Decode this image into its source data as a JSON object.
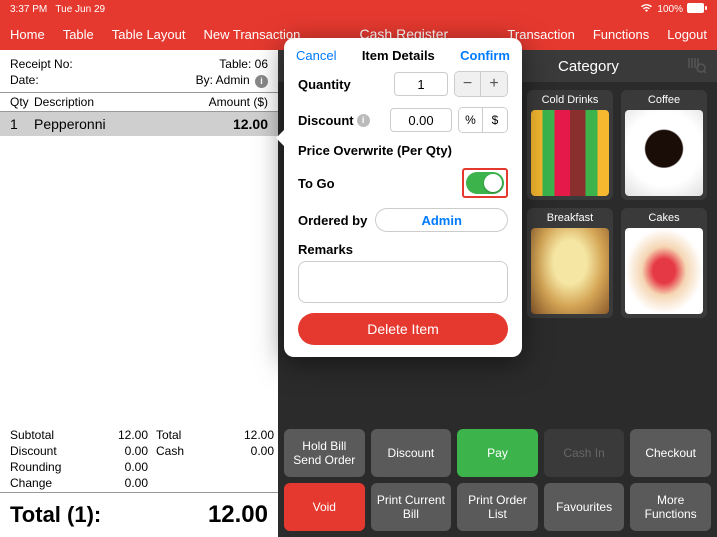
{
  "status": {
    "time": "3:37 PM",
    "date": "Tue Jun 29",
    "battery": "100%"
  },
  "nav": {
    "home": "Home",
    "table": "Table",
    "table_layout": "Table Layout",
    "new_transaction": "New Transaction",
    "title": "Cash Register",
    "transaction": "Transaction",
    "functions": "Functions",
    "logout": "Logout"
  },
  "receipt": {
    "receipt_no_label": "Receipt No:",
    "table_label": "Table: 06",
    "date_label": "Date:",
    "by_label": "By: Admin",
    "col_qty": "Qty",
    "col_desc": "Description",
    "col_amt": "Amount ($)",
    "item_qty": "1",
    "item_desc": "Pepperonni",
    "item_amt": "12.00",
    "subtotal_label": "Subtotal",
    "subtotal_val": "12.00",
    "total_label": "Total",
    "total_val": "12.00",
    "discount_label": "Discount",
    "discount_val": "0.00",
    "cash_label": "Cash",
    "cash_val": "0.00",
    "rounding_label": "Rounding",
    "rounding_val": "0.00",
    "change_label": "Change",
    "change_val": "0.00",
    "grand_label": "Total (1):",
    "grand_val": "12.00"
  },
  "category": {
    "header": "Category",
    "tiles": [
      "Cold Drinks",
      "Coffee",
      "Breakfast",
      "Cakes"
    ]
  },
  "buttons": {
    "hold": "Hold Bill Send Order",
    "discount": "Discount",
    "pay": "Pay",
    "cashin": "Cash In",
    "checkout": "Checkout",
    "void": "Void",
    "print_current": "Print Current Bill",
    "print_order": "Print Order List",
    "favourites": "Favourites",
    "more": "More Functions"
  },
  "popover": {
    "cancel": "Cancel",
    "title": "Item Details",
    "confirm": "Confirm",
    "quantity_label": "Quantity",
    "quantity_val": "1",
    "discount_label": "Discount",
    "discount_val": "0.00",
    "pct": "%",
    "dollar": "$",
    "price_overwrite": "Price Overwrite (Per Qty)",
    "togo_label": "To Go",
    "ordered_label": "Ordered by",
    "ordered_val": "Admin",
    "remarks_label": "Remarks",
    "delete": "Delete Item"
  }
}
